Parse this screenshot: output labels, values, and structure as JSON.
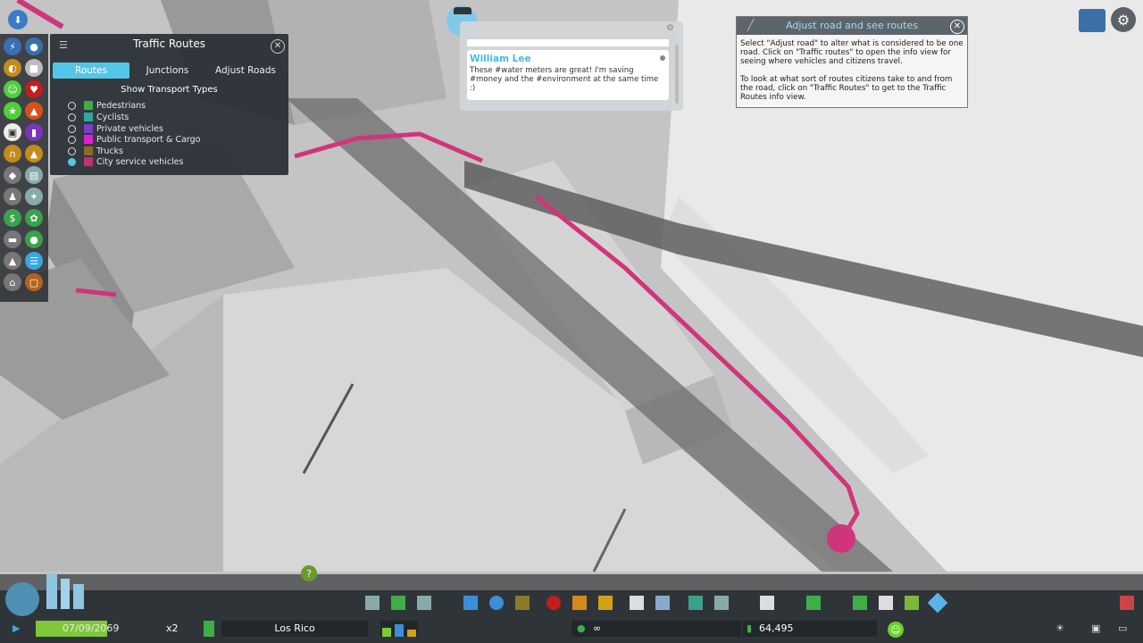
{
  "routes_panel": {
    "title": "Traffic Routes",
    "tabs": [
      "Routes",
      "Junctions",
      "Adjust Roads"
    ],
    "active_tab": "Routes",
    "heading": "Show Transport Types",
    "types": [
      {
        "label": "Pedestrians",
        "color": "#3fae49",
        "selected": false
      },
      {
        "label": "Cyclists",
        "color": "#2fa898",
        "selected": false
      },
      {
        "label": "Private vehicles",
        "color": "#7c3fc9",
        "selected": false
      },
      {
        "label": "Public transport & Cargo",
        "color": "#e21cd6",
        "selected": false
      },
      {
        "label": "Trucks",
        "color": "#8a6a2a",
        "selected": false
      },
      {
        "label": "City service vehicles",
        "color": "#c2306e",
        "selected": true
      }
    ]
  },
  "chirper": {
    "author": "William Lee",
    "message": "These #water meters are great! I'm saving #money and the #environment at the same time :)"
  },
  "tutorial": {
    "title": "Adjust road and see routes",
    "paragraph1": "Select \"Adjust road\" to alter what is considered to be one road. Click on \"Traffic routes\" to open the info view for seeing where vehicles and citizens travel.",
    "paragraph2": "To look at what sort of routes citizens take to and from the road, click on \"Traffic Routes\" to get to the Traffic Routes info view."
  },
  "status_bar": {
    "date": "07/09/2069",
    "speed": "x2",
    "city_name": "Los Rico",
    "money": "64,495",
    "income_symbol": "∞"
  },
  "colors": {
    "route": "#d0357c",
    "accent": "#53c6e8",
    "panel": "#2a3036"
  }
}
